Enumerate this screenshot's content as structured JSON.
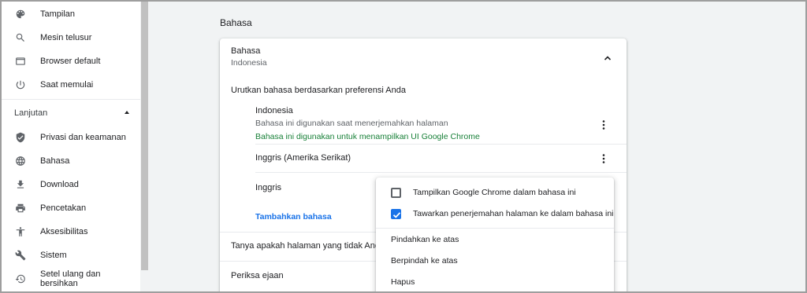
{
  "sidebar": {
    "items_top": [
      {
        "label": "Tampilan",
        "icon": "palette-icon"
      },
      {
        "label": "Mesin telusur",
        "icon": "search-icon"
      },
      {
        "label": "Browser default",
        "icon": "browser-window-icon"
      },
      {
        "label": "Saat memulai",
        "icon": "power-icon"
      }
    ],
    "section_label": "Lanjutan",
    "items_advanced": [
      {
        "label": "Privasi dan keamanan",
        "icon": "shield-icon"
      },
      {
        "label": "Bahasa",
        "icon": "globe-icon"
      },
      {
        "label": "Download",
        "icon": "download-icon"
      },
      {
        "label": "Pencetakan",
        "icon": "printer-icon"
      },
      {
        "label": "Aksesibilitas",
        "icon": "accessibility-icon"
      },
      {
        "label": "Sistem",
        "icon": "wrench-icon"
      },
      {
        "label": "Setel ulang dan bersihkan",
        "icon": "restore-icon"
      }
    ]
  },
  "main": {
    "heading": "Bahasa",
    "card": {
      "title": "Bahasa",
      "subtitle": "Indonesia",
      "order_label": "Urutkan bahasa berdasarkan preferensi Anda",
      "languages": [
        {
          "name": "Indonesia",
          "note": "Bahasa ini digunakan saat menerjemahkan halaman",
          "ui_note": "Bahasa ini digunakan untuk menampilkan UI Google Chrome"
        },
        {
          "name": "Inggris (Amerika Serikat)"
        },
        {
          "name": "Inggris"
        }
      ],
      "add_language": "Tambahkan bahasa",
      "translate_offer": "Tanya apakah halaman yang tidak Anda pa",
      "spellcheck": "Periksa ejaan"
    }
  },
  "menu": {
    "options": [
      {
        "label": "Tampilkan Google Chrome dalam bahasa ini",
        "checked": false
      },
      {
        "label": "Tawarkan penerjemahan halaman ke dalam bahasa ini",
        "checked": true
      }
    ],
    "actions": [
      "Pindahkan ke atas",
      "Berpindah ke atas",
      "Hapus"
    ]
  },
  "colors": {
    "accent": "#1a73e8",
    "green": "#188038",
    "background": "#f1f3f4"
  }
}
